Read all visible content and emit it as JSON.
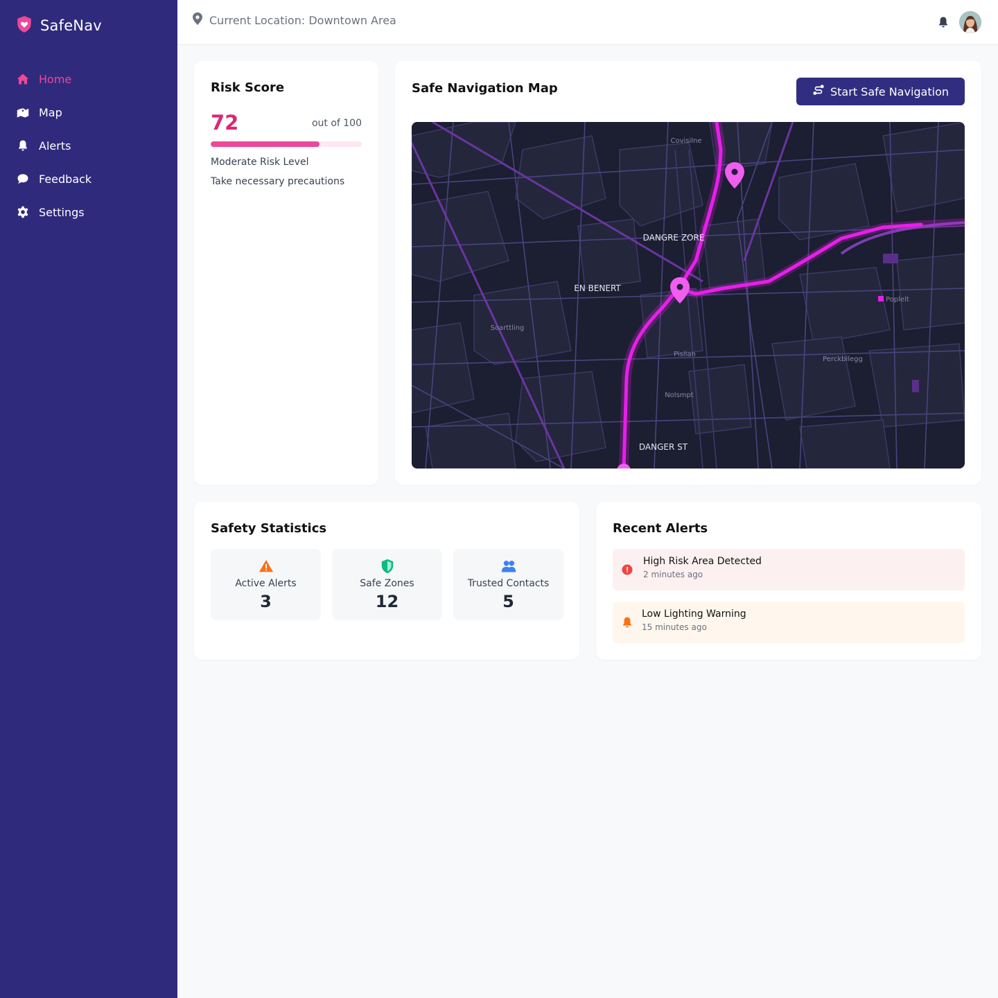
{
  "app": {
    "name": "SafeNav",
    "brand_color": "#ec4899",
    "sidebar_color": "#302a7c"
  },
  "sidebar": {
    "items": [
      {
        "label": "Home",
        "icon": "home-icon",
        "active": true
      },
      {
        "label": "Map",
        "icon": "map-icon",
        "active": false
      },
      {
        "label": "Alerts",
        "icon": "bell-icon",
        "active": false
      },
      {
        "label": "Feedback",
        "icon": "comment-icon",
        "active": false
      },
      {
        "label": "Settings",
        "icon": "gear-icon",
        "active": false
      }
    ]
  },
  "header": {
    "location": "Current Location: Downtown Area",
    "notification_icon": "bell-icon",
    "avatar_icon": "user-avatar"
  },
  "risk": {
    "title": "Risk Score",
    "score": "72",
    "out_of": "out of 100",
    "score_fraction": 0.72,
    "level": "Moderate Risk Level",
    "advice": "Take necessary precautions"
  },
  "map": {
    "title": "Safe Navigation Map",
    "button_label": "Start Safe Navigation",
    "labels": {
      "danger_zone": "DANGRE ZORE",
      "en_benert": "EN BENERT",
      "danger_st": "DANGER ST",
      "soarttling": "Soarttling",
      "poplelt": "Poplelt",
      "perckbllegg": "Perckbllegg",
      "covisilne": "Covisilne",
      "pisllan": "Pisllan",
      "nolsmpt": "Nolsmpt"
    },
    "route_color": "#e520e8"
  },
  "stats": {
    "title": "Safety Statistics",
    "items": [
      {
        "label": "Active Alerts",
        "value": "3",
        "icon": "warning-icon",
        "color": "#f97316"
      },
      {
        "label": "Safe Zones",
        "value": "12",
        "icon": "shield-icon",
        "color": "#10b981"
      },
      {
        "label": "Trusted Contacts",
        "value": "5",
        "icon": "users-icon",
        "color": "#3b82f6"
      }
    ]
  },
  "alerts": {
    "title": "Recent Alerts",
    "items": [
      {
        "title": "High Risk Area Detected",
        "time": "2 minutes ago",
        "icon": "exclamation-circle-icon",
        "color": "#ef4444"
      },
      {
        "title": "Low Lighting Warning",
        "time": "15 minutes ago",
        "icon": "bell-icon",
        "color": "#f97316"
      }
    ]
  }
}
